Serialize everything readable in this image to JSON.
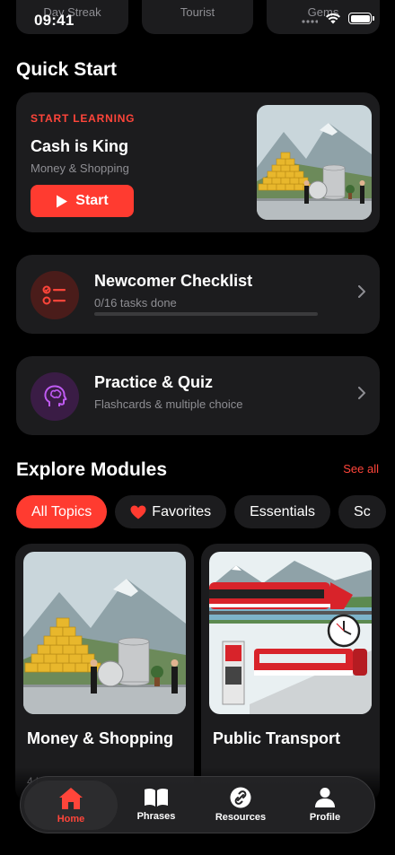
{
  "status_bar": {
    "time": "09:41"
  },
  "stats": [
    {
      "label": "Day Streak"
    },
    {
      "label": "Tourist"
    },
    {
      "label": "Gems"
    }
  ],
  "quick_start": {
    "title": "Quick Start",
    "kicker": "START LEARNING",
    "lesson_title": "Cash is King",
    "lesson_subtitle": "Money & Shopping",
    "start_label": "Start"
  },
  "checklist": {
    "title": "Newcomer Checklist",
    "subtitle": "0/16 tasks done",
    "progress": 0
  },
  "practice": {
    "title": "Practice & Quiz",
    "subtitle": "Flashcards & multiple choice"
  },
  "explore": {
    "title": "Explore Modules",
    "see_all": "See all",
    "chips": [
      {
        "label": "All Topics",
        "active": true
      },
      {
        "label": "Favorites",
        "icon": "heart-icon"
      },
      {
        "label": "Essentials"
      },
      {
        "label": "Sc"
      }
    ],
    "modules": [
      {
        "title": "Money & Shopping",
        "meta": "4 l"
      },
      {
        "title": "Public Transport",
        "meta": ""
      }
    ]
  },
  "tabs": [
    {
      "label": "Home",
      "icon": "home-icon",
      "active": true
    },
    {
      "label": "Phrases",
      "icon": "book-icon"
    },
    {
      "label": "Resources",
      "icon": "link-icon"
    },
    {
      "label": "Profile",
      "icon": "person-icon"
    }
  ],
  "colors": {
    "accent": "#ff3b30",
    "card": "#1c1c1e",
    "background": "#000000",
    "muted": "#8e8e93"
  }
}
